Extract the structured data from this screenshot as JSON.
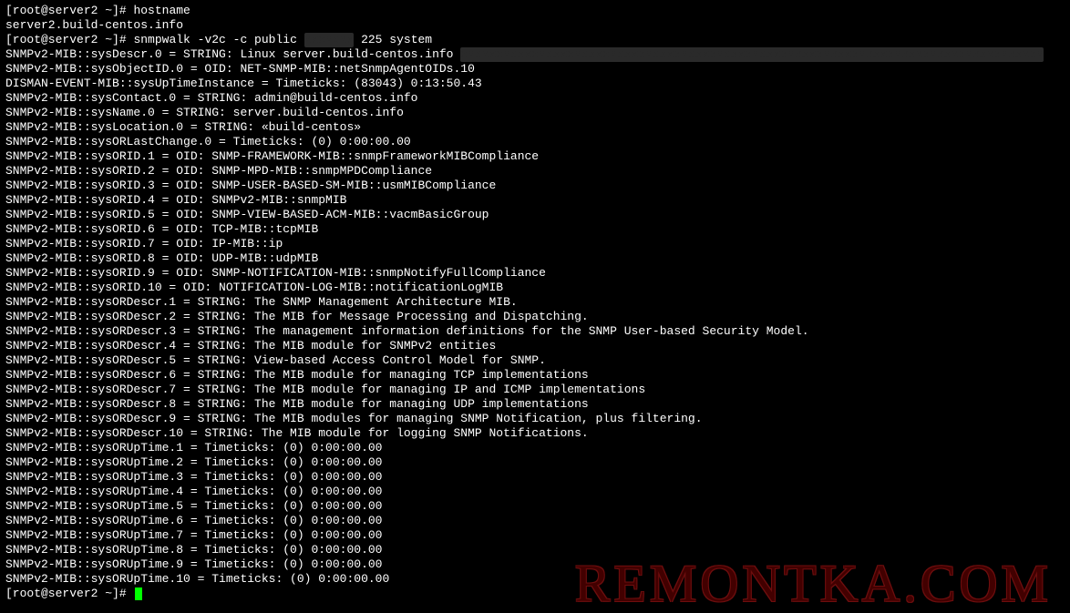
{
  "prompt1": "[root@server2 ~]# ",
  "cmd1": "hostname",
  "hostname_out": "server2.build-centos.info",
  "prompt2": "[root@server2 ~]# ",
  "cmd2a": "snmpwalk -v2c -c public ",
  "cmd2b": " 225 system",
  "snmp": {
    "l0a": "SNMPv2-MIB::sysDescr.0 = STRING: Linux server.build-centos.info ",
    "l1": "SNMPv2-MIB::sysObjectID.0 = OID: NET-SNMP-MIB::netSnmpAgentOIDs.10",
    "l2": "DISMAN-EVENT-MIB::sysUpTimeInstance = Timeticks: (83043) 0:13:50.43",
    "l3": "SNMPv2-MIB::sysContact.0 = STRING: admin@build-centos.info",
    "l4": "SNMPv2-MIB::sysName.0 = STRING: server.build-centos.info",
    "l5": "SNMPv2-MIB::sysLocation.0 = STRING: «build-centos»",
    "l6": "SNMPv2-MIB::sysORLastChange.0 = Timeticks: (0) 0:00:00.00",
    "l7": "SNMPv2-MIB::sysORID.1 = OID: SNMP-FRAMEWORK-MIB::snmpFrameworkMIBCompliance",
    "l8": "SNMPv2-MIB::sysORID.2 = OID: SNMP-MPD-MIB::snmpMPDCompliance",
    "l9": "SNMPv2-MIB::sysORID.3 = OID: SNMP-USER-BASED-SM-MIB::usmMIBCompliance",
    "l10": "SNMPv2-MIB::sysORID.4 = OID: SNMPv2-MIB::snmpMIB",
    "l11": "SNMPv2-MIB::sysORID.5 = OID: SNMP-VIEW-BASED-ACM-MIB::vacmBasicGroup",
    "l12": "SNMPv2-MIB::sysORID.6 = OID: TCP-MIB::tcpMIB",
    "l13": "SNMPv2-MIB::sysORID.7 = OID: IP-MIB::ip",
    "l14": "SNMPv2-MIB::sysORID.8 = OID: UDP-MIB::udpMIB",
    "l15": "SNMPv2-MIB::sysORID.9 = OID: SNMP-NOTIFICATION-MIB::snmpNotifyFullCompliance",
    "l16": "SNMPv2-MIB::sysORID.10 = OID: NOTIFICATION-LOG-MIB::notificationLogMIB",
    "l17": "SNMPv2-MIB::sysORDescr.1 = STRING: The SNMP Management Architecture MIB.",
    "l18": "SNMPv2-MIB::sysORDescr.2 = STRING: The MIB for Message Processing and Dispatching.",
    "l19": "SNMPv2-MIB::sysORDescr.3 = STRING: The management information definitions for the SNMP User-based Security Model.",
    "l20": "SNMPv2-MIB::sysORDescr.4 = STRING: The MIB module for SNMPv2 entities",
    "l21": "SNMPv2-MIB::sysORDescr.5 = STRING: View-based Access Control Model for SNMP.",
    "l22": "SNMPv2-MIB::sysORDescr.6 = STRING: The MIB module for managing TCP implementations",
    "l23": "SNMPv2-MIB::sysORDescr.7 = STRING: The MIB module for managing IP and ICMP implementations",
    "l24": "SNMPv2-MIB::sysORDescr.8 = STRING: The MIB module for managing UDP implementations",
    "l25": "SNMPv2-MIB::sysORDescr.9 = STRING: The MIB modules for managing SNMP Notification, plus filtering.",
    "l26": "SNMPv2-MIB::sysORDescr.10 = STRING: The MIB module for logging SNMP Notifications.",
    "l27": "SNMPv2-MIB::sysORUpTime.1 = Timeticks: (0) 0:00:00.00",
    "l28": "SNMPv2-MIB::sysORUpTime.2 = Timeticks: (0) 0:00:00.00",
    "l29": "SNMPv2-MIB::sysORUpTime.3 = Timeticks: (0) 0:00:00.00",
    "l30": "SNMPv2-MIB::sysORUpTime.4 = Timeticks: (0) 0:00:00.00",
    "l31": "SNMPv2-MIB::sysORUpTime.5 = Timeticks: (0) 0:00:00.00",
    "l32": "SNMPv2-MIB::sysORUpTime.6 = Timeticks: (0) 0:00:00.00",
    "l33": "SNMPv2-MIB::sysORUpTime.7 = Timeticks: (0) 0:00:00.00",
    "l34": "SNMPv2-MIB::sysORUpTime.8 = Timeticks: (0) 0:00:00.00",
    "l35": "SNMPv2-MIB::sysORUpTime.9 = Timeticks: (0) 0:00:00.00",
    "l36": "SNMPv2-MIB::sysORUpTime.10 = Timeticks: (0) 0:00:00.00"
  },
  "prompt3": "[root@server2 ~]# ",
  "watermark": "REMONTKA.COM"
}
